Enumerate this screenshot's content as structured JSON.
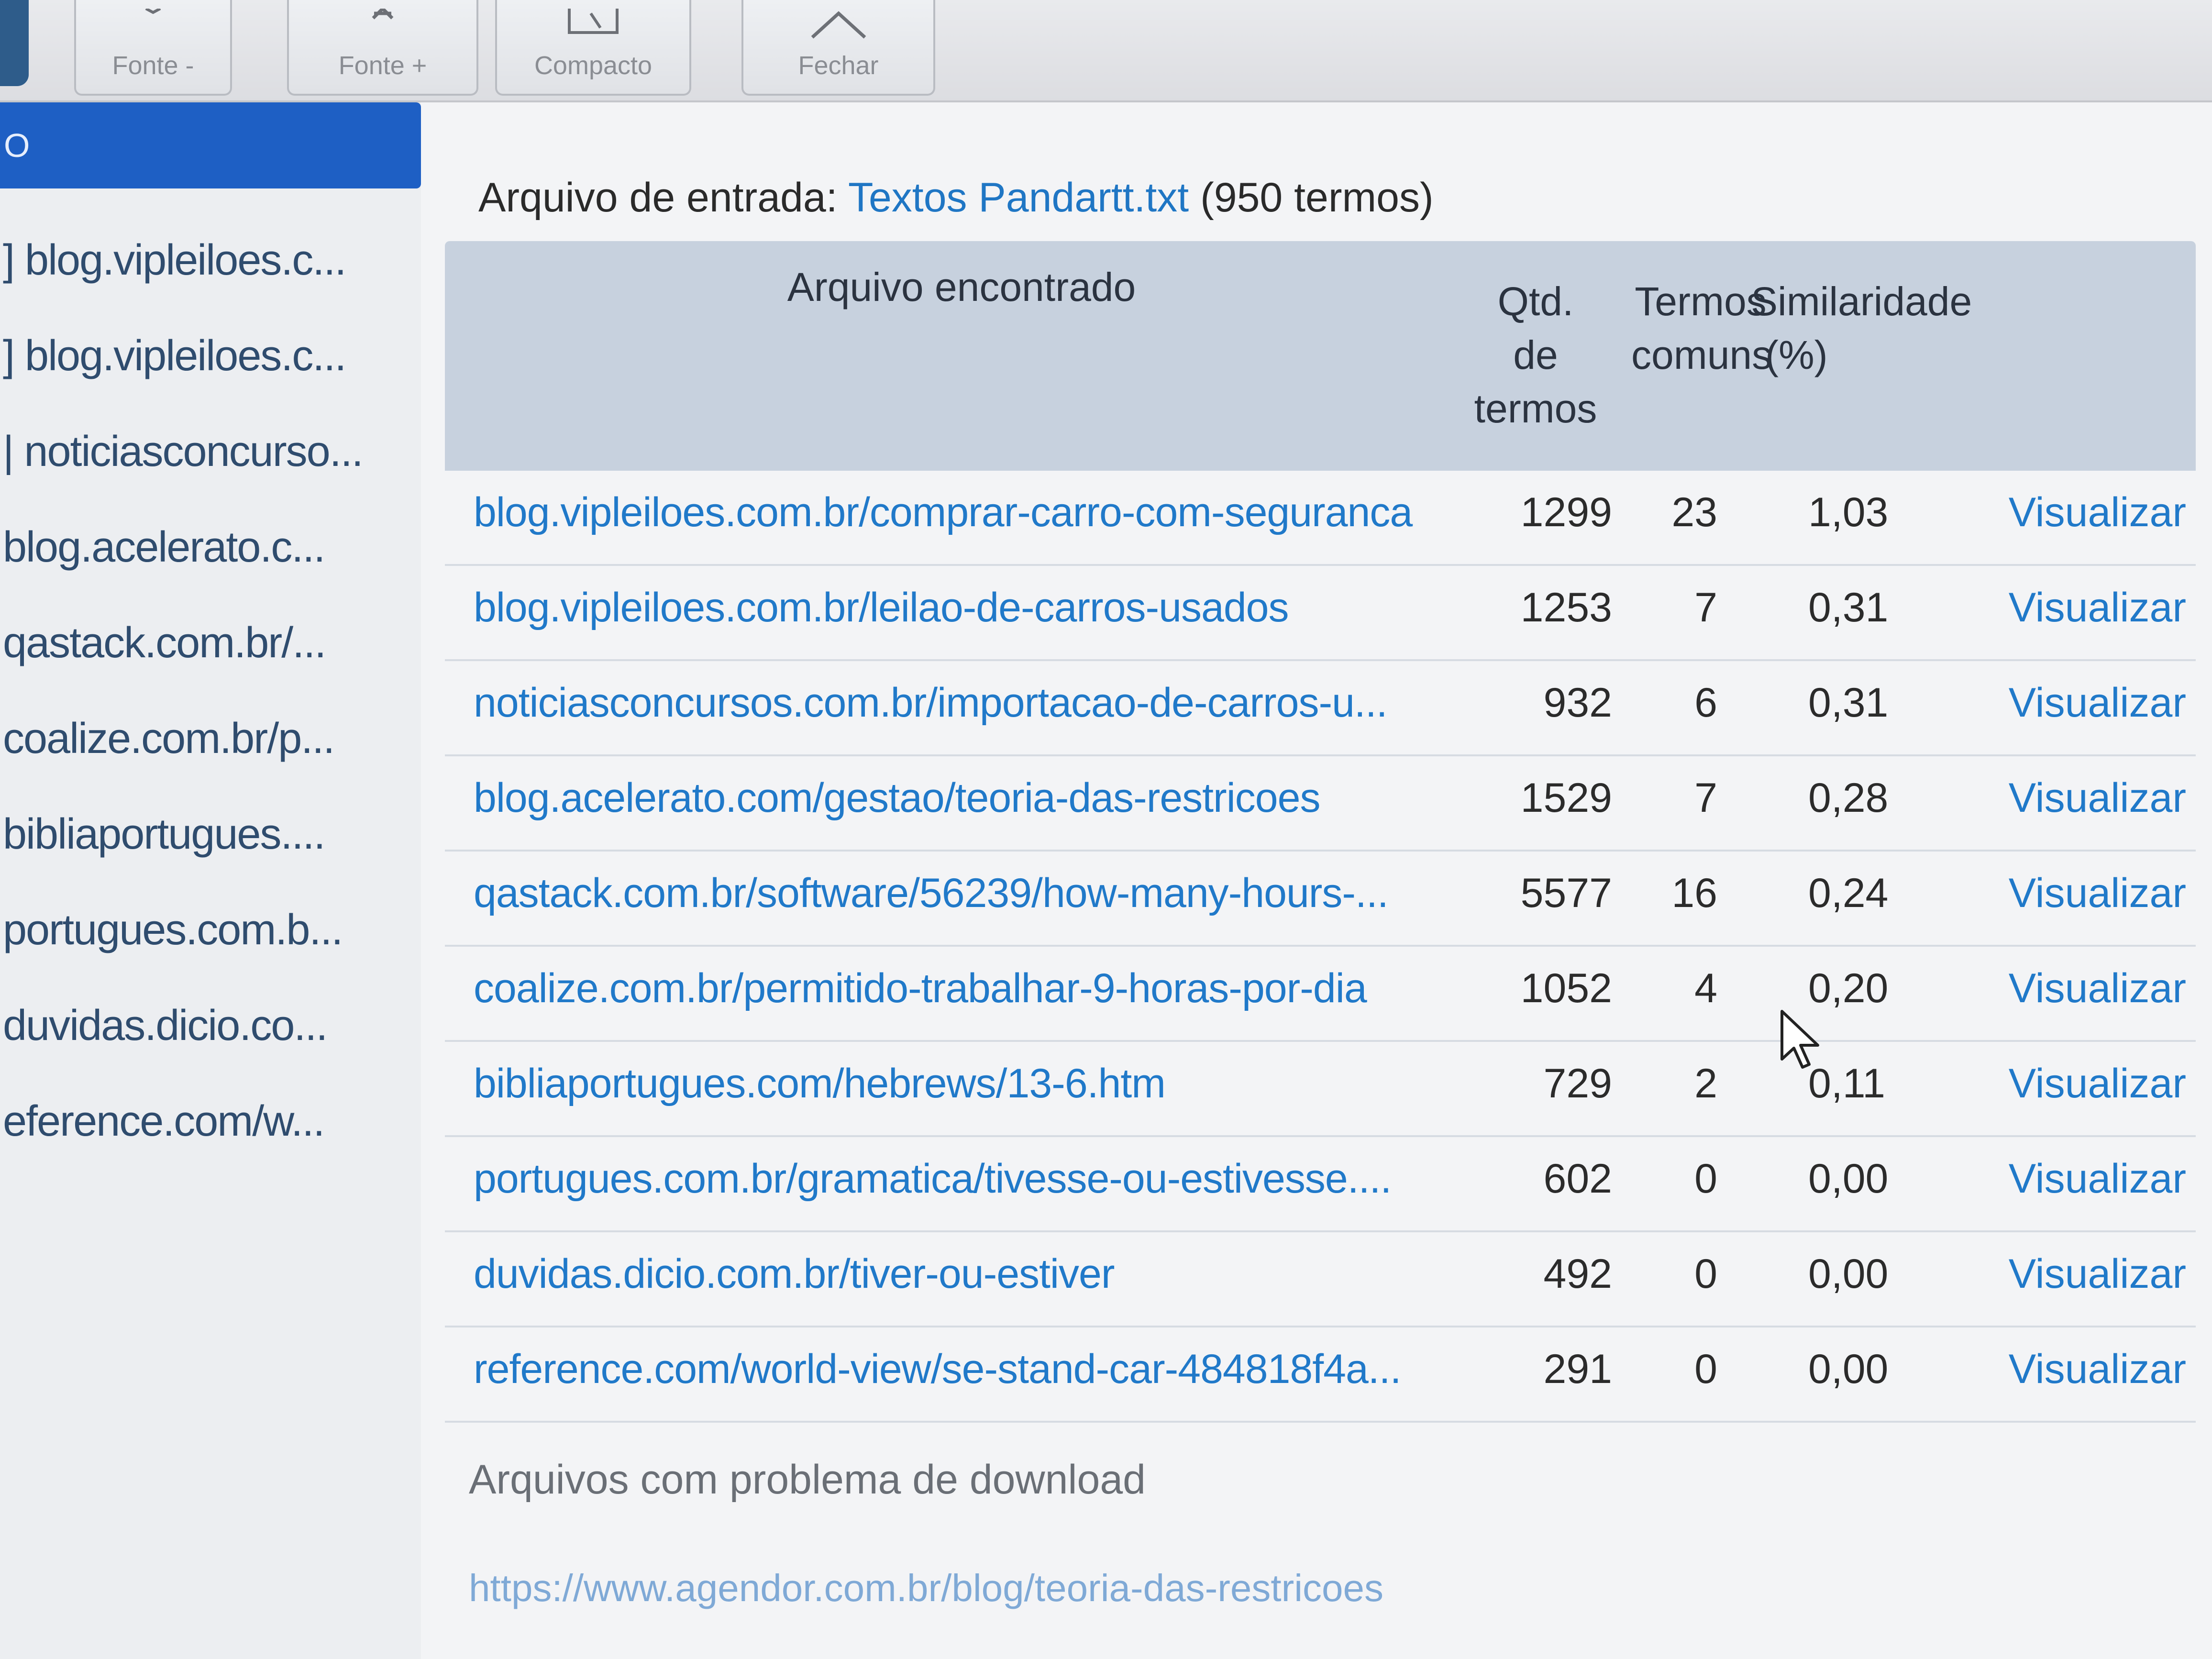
{
  "toolbar": {
    "buttons": [
      {
        "label": "Fonte -",
        "icon": "font-decrease-icon"
      },
      {
        "label": "Fonte +",
        "icon": "font-increase-icon"
      },
      {
        "label": "Compacto",
        "icon": "compact-icon"
      },
      {
        "label": "Fechar",
        "icon": "close-chevron-icon"
      }
    ]
  },
  "sidebar": {
    "header": "O",
    "items": [
      {
        "label": "] blog.vipleiloes.c..."
      },
      {
        "label": "] blog.vipleiloes.c..."
      },
      {
        "label": "| noticiasconcurso..."
      },
      {
        "label": "blog.acelerato.c..."
      },
      {
        "label": "qastack.com.br/..."
      },
      {
        "label": "coalize.com.br/p..."
      },
      {
        "label": "bibliaportugues...."
      },
      {
        "label": "portugues.com.b..."
      },
      {
        "label": "duvidas.dicio.co..."
      },
      {
        "label": "eference.com/w..."
      }
    ]
  },
  "main": {
    "input_label": "Arquivo de entrada:",
    "input_file": "Textos Pandartt.txt",
    "input_terms": "(950 termos)",
    "headers": {
      "file": "Arquivo encontrado",
      "qtd_l1": "Qtd.",
      "qtd_l2": "de",
      "qtd_l3": "termos",
      "common_l1": "Termos",
      "common_l2": "comuns",
      "sim_l1": "Similaridade",
      "sim_l2": "(%)"
    },
    "rows": [
      {
        "file": "blog.vipleiloes.com.br/comprar-carro-com-seguranca",
        "qtd": "1299",
        "common": "23",
        "sim": "1,03",
        "action": "Visualizar"
      },
      {
        "file": "blog.vipleiloes.com.br/leilao-de-carros-usados",
        "qtd": "1253",
        "common": "7",
        "sim": "0,31",
        "action": "Visualizar"
      },
      {
        "file": "noticiasconcursos.com.br/importacao-de-carros-u...",
        "qtd": "932",
        "common": "6",
        "sim": "0,31",
        "action": "Visualizar"
      },
      {
        "file": "blog.acelerato.com/gestao/teoria-das-restricoes",
        "qtd": "1529",
        "common": "7",
        "sim": "0,28",
        "action": "Visualizar"
      },
      {
        "file": "qastack.com.br/software/56239/how-many-hours-...",
        "qtd": "5577",
        "common": "16",
        "sim": "0,24",
        "action": "Visualizar"
      },
      {
        "file": "coalize.com.br/permitido-trabalhar-9-horas-por-dia",
        "qtd": "1052",
        "common": "4",
        "sim": "0,20",
        "action": "Visualizar"
      },
      {
        "file": "bibliaportugues.com/hebrews/13-6.htm",
        "qtd": "729",
        "common": "2",
        "sim": "0,11",
        "action": "Visualizar"
      },
      {
        "file": "portugues.com.br/gramatica/tivesse-ou-estivesse....",
        "qtd": "602",
        "common": "0",
        "sim": "0,00",
        "action": "Visualizar"
      },
      {
        "file": "duvidas.dicio.com.br/tiver-ou-estiver",
        "qtd": "492",
        "common": "0",
        "sim": "0,00",
        "action": "Visualizar"
      },
      {
        "file": "reference.com/world-view/se-stand-car-484818f4a...",
        "qtd": "291",
        "common": "0",
        "sim": "0,00",
        "action": "Visualizar"
      }
    ],
    "download_title": "Arquivos com problema de download",
    "download_link": "https://www.agendor.com.br/blog/teoria-das-restricoes"
  }
}
